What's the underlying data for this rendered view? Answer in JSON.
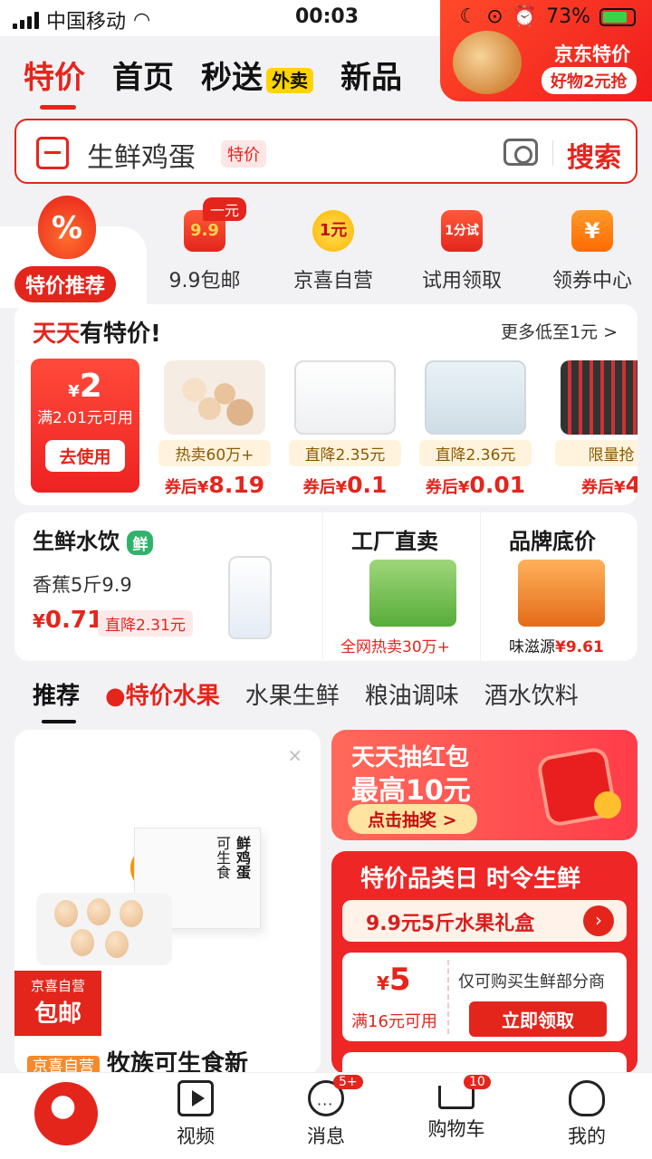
{
  "status_bar": {
    "carrier": "中国移动",
    "time": "00:03",
    "battery": "73%"
  },
  "header_promo": {
    "title": "京东特价",
    "subtitle": "好物2元抢"
  },
  "top_tabs": [
    {
      "label": "特价",
      "active": true
    },
    {
      "label": "首页"
    },
    {
      "label": "秒送"
    },
    {
      "label": "新品"
    }
  ],
  "waimai_badge": "外卖",
  "search": {
    "query": "生鲜鸡蛋",
    "tag": "特价",
    "button": "搜索"
  },
  "categories": {
    "main_icon": "%",
    "main_label": "特价推荐",
    "items": [
      {
        "icon_text": "9.9",
        "label": "9.9包邮",
        "badge": "一元"
      },
      {
        "icon_text": "1元",
        "label": "京喜自营"
      },
      {
        "icon_text": "1分试",
        "label": "试用领取"
      },
      {
        "icon_text": "¥",
        "label": "领券中心"
      }
    ]
  },
  "daily_deals": {
    "title_red": "天天",
    "title_black": "有特价!",
    "more": "更多低至1元 >",
    "coupon": {
      "currency": "¥",
      "amount": "2",
      "condition": "满2.01元可用",
      "button": "去使用"
    },
    "items": [
      {
        "label": "热卖60万+",
        "price_prefix": "券后¥",
        "price": "8.19"
      },
      {
        "label": "直降2.35元",
        "price_prefix": "券后¥",
        "price": "0.1"
      },
      {
        "label": "直降2.36元",
        "price_prefix": "券后¥",
        "price": "0.01"
      },
      {
        "label": "限量抢",
        "price_prefix": "券后¥",
        "price": "4"
      }
    ]
  },
  "fresh": {
    "title": "生鲜水饮",
    "tag": "鲜",
    "product": "香蕉5斤9.9",
    "currency": "¥",
    "price": "0.71",
    "drop": "直降2.31元"
  },
  "factory": {
    "title": "工厂直卖",
    "sub": "全网热卖30万+"
  },
  "brand": {
    "title": "品牌底价",
    "sub_name": "味滋源",
    "sub_price": "¥9.61"
  },
  "feed_tabs": [
    {
      "label": "推荐",
      "active": true
    },
    {
      "label": "特价水果",
      "highlight": true
    },
    {
      "label": "水果生鲜"
    },
    {
      "label": "粮油调味"
    },
    {
      "label": "酒水饮料"
    }
  ],
  "feed_left": {
    "close": "×",
    "box_text": "鲜鸡蛋",
    "box_text2": "可生食",
    "badge_top": "京喜自营",
    "badge_main": "包邮",
    "title_tag": "京喜自营",
    "title": "牧族可生食新"
  },
  "red_packet": {
    "line1": "天天抽红包",
    "line2": "最高10元",
    "button": "点击抽奖 >"
  },
  "category_day": {
    "header": "特价品类日 时令生鲜",
    "fruit_box": "9.9元5斤水果礼盒",
    "coupon_currency": "¥",
    "coupon_amount": "5",
    "coupon_condition": "满16元可用",
    "coupon_desc": "仅可购买生鲜部分商",
    "coupon_button": "立即领取"
  },
  "bottom_nav": [
    {
      "label": "视频",
      "icon": "play-icon"
    },
    {
      "label": "消息",
      "icon": "message-icon",
      "badge": "5+"
    },
    {
      "label": "购物车",
      "icon": "cart-icon",
      "badge": "10"
    },
    {
      "label": "我的",
      "icon": "profile-icon"
    }
  ],
  "colors": {
    "accent": "#e4251c",
    "fresh_green": "#2fb36b",
    "yellow": "#ffd400"
  }
}
